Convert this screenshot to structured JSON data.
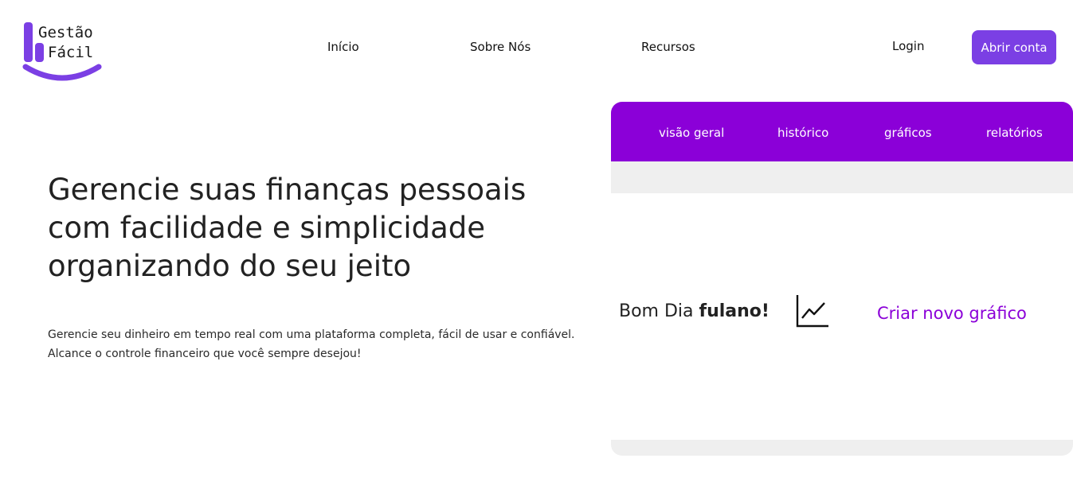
{
  "logo": {
    "line1": "Gestão",
    "line2": "Fácil"
  },
  "nav": {
    "items": [
      {
        "label": "Início"
      },
      {
        "label": "Sobre Nós"
      },
      {
        "label": "Recursos"
      }
    ],
    "login_label": "Login",
    "signup_label": "Abrir conta"
  },
  "hero": {
    "title_lines": [
      "Gerencie suas finanças pessoais",
      "com facilidade e simplicidade",
      "organizando do seu jeito"
    ],
    "description_lines": [
      "Gerencie seu dinheiro em tempo real com uma plataforma completa, fácil de usar e confiável.",
      "Alcance o controle financeiro que você sempre desejou!"
    ]
  },
  "dashboard": {
    "tabs": [
      {
        "label": "visão geral"
      },
      {
        "label": "histórico"
      },
      {
        "label": "gráficos"
      },
      {
        "label": "relatórios"
      }
    ],
    "greeting_prefix": "Bom Dia ",
    "user_name": "fulano!",
    "new_chart_label": "Criar novo gráfico",
    "chart_icon": "line-chart-icon"
  },
  "colors": {
    "brand_purple": "#7b3fe4",
    "tab_bar_purple": "#8b00d8",
    "card_gray": "#efefef"
  }
}
